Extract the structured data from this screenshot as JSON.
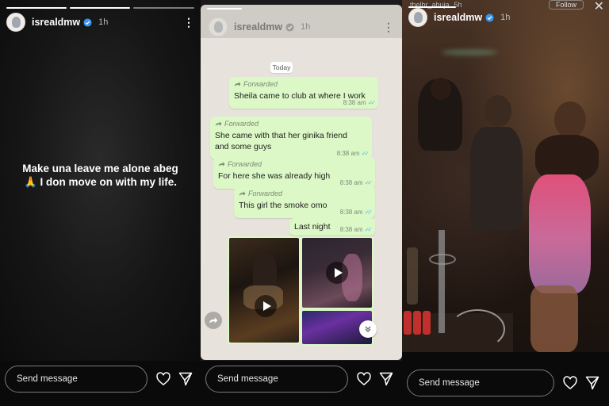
{
  "story1": {
    "username": "isrealdmw",
    "time": "1h",
    "text": "Make una leave me alone abeg 🙏 I don move on with my life.",
    "message_placeholder": "Send message"
  },
  "story2": {
    "username": "isrealdmw",
    "time": "1h",
    "date_chip": "Today",
    "messages": [
      {
        "forwarded": "Forwarded",
        "text": "Sheila came to club at where I work",
        "time": "8:38 am"
      },
      {
        "forwarded": "Forwarded",
        "text": "She came with that her ginika friend and some guys",
        "time": "8:38 am"
      },
      {
        "forwarded": "Forwarded",
        "text": "For here she was already high",
        "time": "8:38 am"
      },
      {
        "forwarded": "Forwarded",
        "text": "This girl the smoke omo",
        "time": "8:38 am"
      },
      {
        "forwarded": "",
        "text": "Last night",
        "time": "8:38 am"
      }
    ],
    "message_placeholder": "Send message"
  },
  "story3": {
    "prev_username": "thelbr_abuja",
    "prev_time": "5h",
    "follow_label": "Follow",
    "username": "isrealdmw",
    "time": "1h",
    "message_placeholder": "Send message"
  },
  "colors": {
    "bubble": "#dcf8c6",
    "chat_bg": "#e7e3dc",
    "verified": "#3897f0",
    "read_ticks": "#53bdeb"
  },
  "icons": [
    "verified-badge-icon",
    "more-options-icon",
    "heart-icon",
    "send-icon",
    "forward-arrow-icon",
    "play-icon",
    "share-icon",
    "chevron-down-icon",
    "close-icon"
  ]
}
